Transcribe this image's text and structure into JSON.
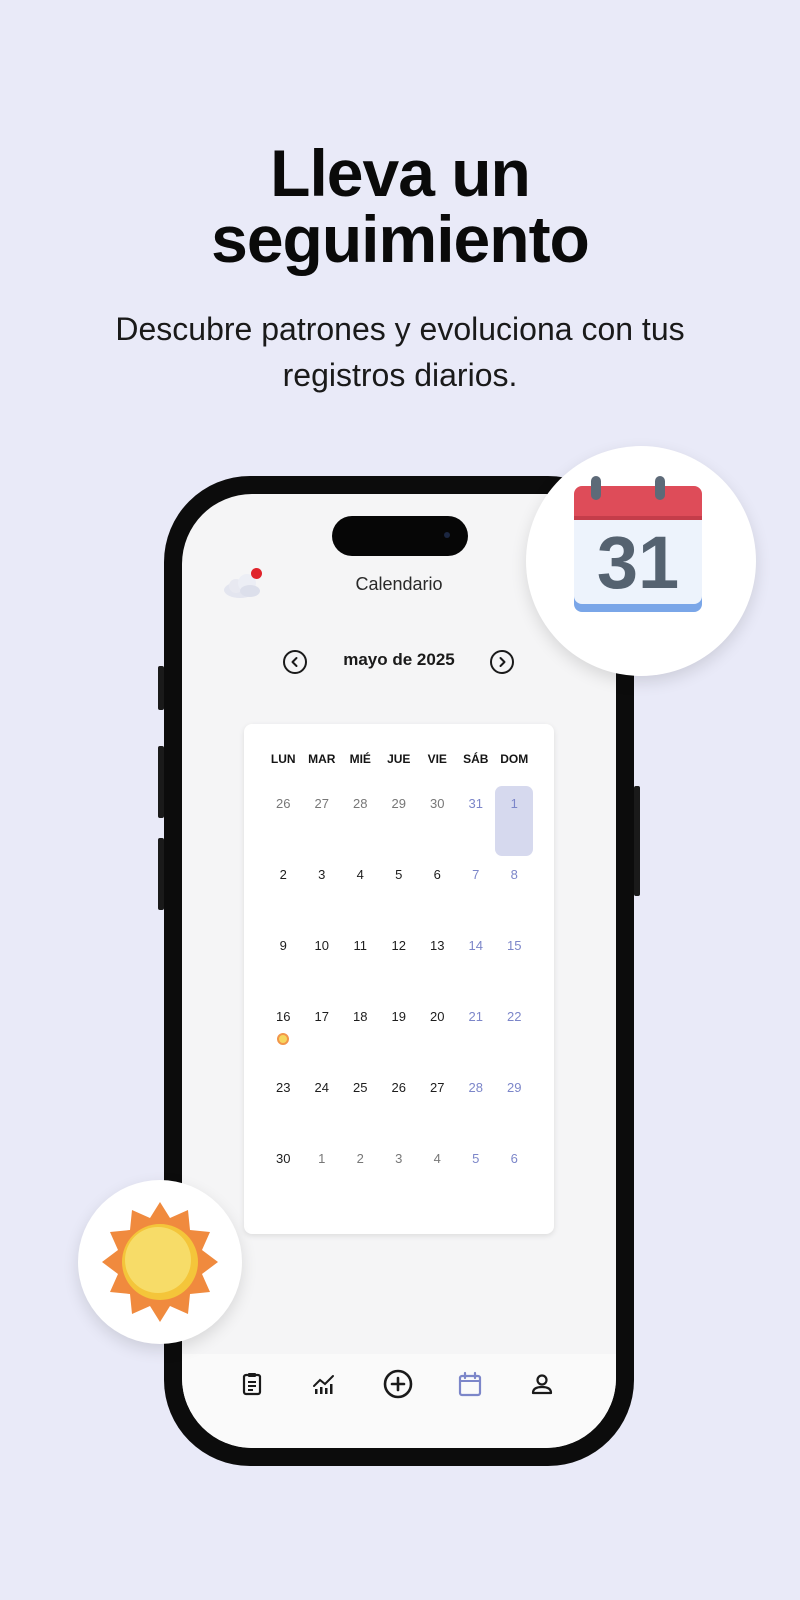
{
  "hero": {
    "title_line1": "Lleva un",
    "title_line2": "seguimiento",
    "subtitle": "Descubre patrones y evoluciona con tus registros diarios."
  },
  "app": {
    "screen_title": "Calendario",
    "month_label": "mayo de 2025",
    "weekdays": [
      "LUN",
      "MAR",
      "MIÉ",
      "JUE",
      "VIE",
      "SÁB",
      "DOM"
    ],
    "days": [
      {
        "n": "26",
        "type": "other"
      },
      {
        "n": "27",
        "type": "other"
      },
      {
        "n": "28",
        "type": "other"
      },
      {
        "n": "29",
        "type": "other"
      },
      {
        "n": "30",
        "type": "other"
      },
      {
        "n": "31",
        "type": "weekend"
      },
      {
        "n": "1",
        "type": "weekend",
        "selected": true
      },
      {
        "n": "2",
        "type": "cur"
      },
      {
        "n": "3",
        "type": "cur"
      },
      {
        "n": "4",
        "type": "cur"
      },
      {
        "n": "5",
        "type": "cur"
      },
      {
        "n": "6",
        "type": "cur"
      },
      {
        "n": "7",
        "type": "weekend"
      },
      {
        "n": "8",
        "type": "weekend"
      },
      {
        "n": "9",
        "type": "cur"
      },
      {
        "n": "10",
        "type": "cur"
      },
      {
        "n": "11",
        "type": "cur"
      },
      {
        "n": "12",
        "type": "cur"
      },
      {
        "n": "13",
        "type": "cur"
      },
      {
        "n": "14",
        "type": "weekend"
      },
      {
        "n": "15",
        "type": "weekend"
      },
      {
        "n": "16",
        "type": "cur",
        "mood": "sun"
      },
      {
        "n": "17",
        "type": "cur"
      },
      {
        "n": "18",
        "type": "cur"
      },
      {
        "n": "19",
        "type": "cur"
      },
      {
        "n": "20",
        "type": "cur"
      },
      {
        "n": "21",
        "type": "weekend"
      },
      {
        "n": "22",
        "type": "weekend"
      },
      {
        "n": "23",
        "type": "cur"
      },
      {
        "n": "24",
        "type": "cur"
      },
      {
        "n": "25",
        "type": "cur"
      },
      {
        "n": "26",
        "type": "cur"
      },
      {
        "n": "27",
        "type": "cur"
      },
      {
        "n": "28",
        "type": "weekend"
      },
      {
        "n": "29",
        "type": "weekend"
      },
      {
        "n": "30",
        "type": "cur"
      },
      {
        "n": "1",
        "type": "other"
      },
      {
        "n": "2",
        "type": "other"
      },
      {
        "n": "3",
        "type": "other"
      },
      {
        "n": "4",
        "type": "other"
      },
      {
        "n": "5",
        "type": "weekend"
      },
      {
        "n": "6",
        "type": "weekend"
      }
    ],
    "calendar_badge_number": "31",
    "tabs": [
      {
        "icon": "clipboard-icon",
        "active": false
      },
      {
        "icon": "chart-icon",
        "active": false
      },
      {
        "icon": "add-circle-icon",
        "active": false
      },
      {
        "icon": "calendar-icon",
        "active": true
      },
      {
        "icon": "profile-icon",
        "active": false
      }
    ]
  },
  "colors": {
    "background": "#e9eaf8",
    "accent": "#7c86c9",
    "selected_day": "#d6d9ee",
    "notification": "#e0232b"
  }
}
